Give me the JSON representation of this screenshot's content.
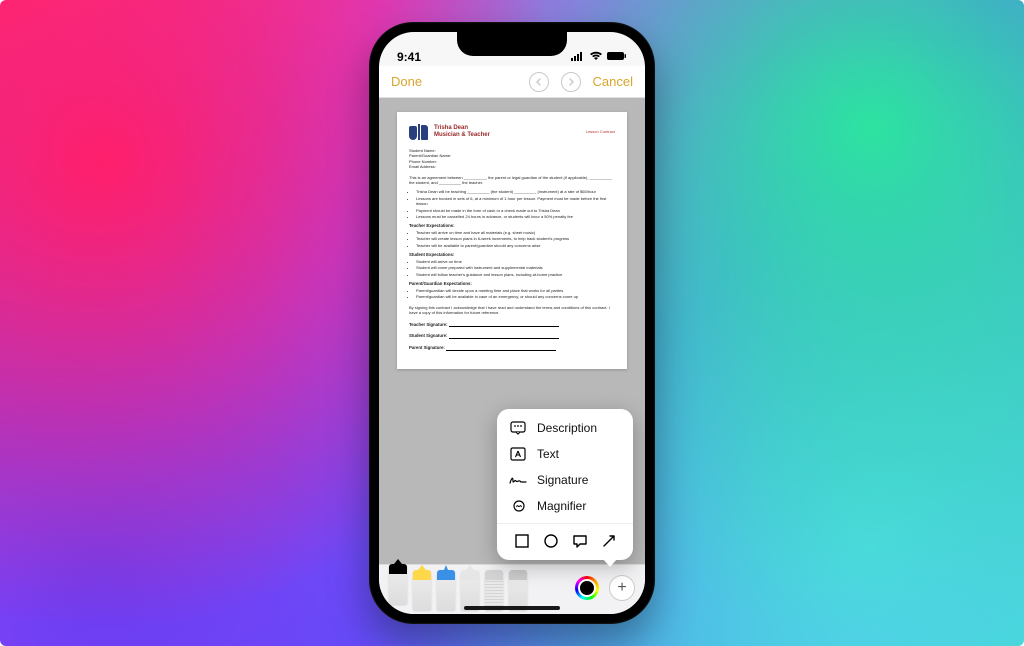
{
  "statusbar": {
    "time": "9:41"
  },
  "nav": {
    "done": "Done",
    "cancel": "Cancel"
  },
  "document": {
    "badge": "Lesson Contract",
    "title_line1": "Trisha Dean",
    "title_line2": "Musician & Teacher",
    "fields": {
      "student_name": "Student Name:",
      "parent_name": "Parent/Guardian Name:",
      "phone": "Phone Number:",
      "email": "Email Address:"
    },
    "agreement": "This is an agreement between __________, the parent or legal guardian of the student (if applicable), __________ the student, and __________ the teacher.",
    "terms": [
      "Trisha Dean will be teaching __________ (the student) __________ (instrument) at a rate of $60/hour",
      "Lessons are booked in sets of 6, at a minimum of 1 hour per lesson. Payment must be made before the first lesson",
      "Payment should be made in the form of cash or a check made out to Trisha Dean",
      "Lessons must be cancelled 24 hours in advance, or students will incur a 50% penalty fee"
    ],
    "teacher_exp_h": "Teacher Expectations:",
    "teacher_exp": [
      "Teacher will arrive on time and have all materials (e.g. sheet music)",
      "Teacher will create lesson plans in 6-week increments, to help track student's progress",
      "Teacher will be available to parent/guardian should any concerns arise"
    ],
    "student_exp_h": "Student Expectations:",
    "student_exp": [
      "Student will arrive on time",
      "Student will come prepared with instrument and supplemental materials",
      "Student will follow teacher's guidance and lesson plans, including at-home practice"
    ],
    "parent_exp_h": "Parent/Guardian Expectations:",
    "parent_exp": [
      "Parent/guardian will decide upon a meeting time and place that works for all parties",
      "Parent/guardian will be available in case of an emergency, or should any concerns come up"
    ],
    "sign_ack": "By signing this contract I acknowledge that I have read and understand the terms and conditions of this contract. I have a copy of this information for future reference.",
    "sig_teacher": "Teacher Signature:",
    "sig_student": "Student Signature:",
    "sig_parent": "Parent Signature:"
  },
  "popover": {
    "description": "Description",
    "text": "Text",
    "signature": "Signature",
    "magnifier": "Magnifier"
  }
}
